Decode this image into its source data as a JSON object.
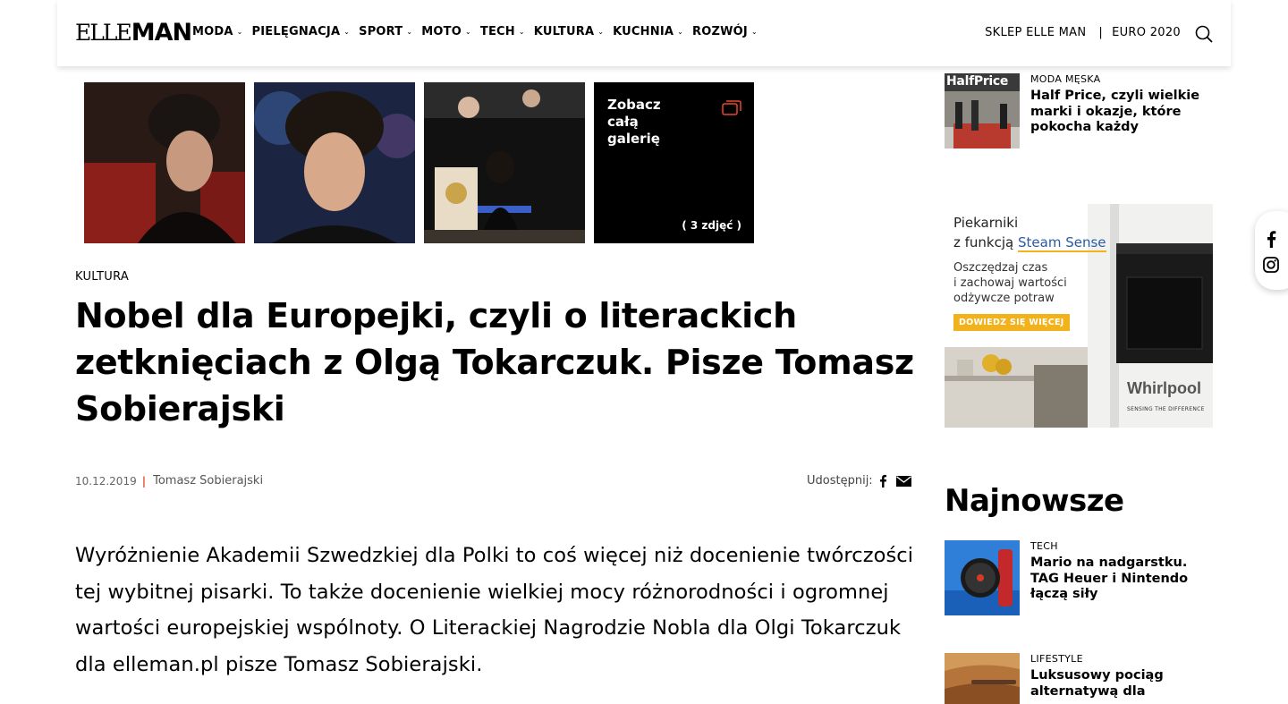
{
  "header": {
    "logo_elle": "ELLE",
    "logo_man": "MAN",
    "nav": [
      "MODA",
      "PIELĘGNACJA",
      "SPORT",
      "MOTO",
      "TECH",
      "KULTURA",
      "KUCHNIA",
      "ROZWÓJ"
    ],
    "shop_link": "SKLEP ELLE MAN",
    "separator": "|",
    "euro_link": "EURO 2020"
  },
  "gallery": {
    "more_label": "Zobacz całą galerię",
    "count": "( 3 zdjęć )"
  },
  "article": {
    "category": "KULTURA",
    "title": "Nobel dla Europejki, czyli o literackich zetknięciach z Olgą Tokarczuk. Pisze Tomasz Sobierajski",
    "date": "10.12.2019",
    "meta_separator": "|",
    "author": "Tomasz Sobierajski",
    "share_label": "Udostępnij:",
    "lead": "Wyróżnienie Akademii Szwedzkiej dla Polki to coś więcej niż docenienie twórczości tej wybitnej pisarki. To także docenienie wielkiej mocy różnorodności i ogromnej wartości europejskiej wspólnoty. O Literackiej Nagrodzie Nobla dla Olgi Tokarczuk dla elleman.pl pisze Tomasz Sobierajski."
  },
  "sidebar": {
    "top_item": {
      "thumb_text": "HalfPrice",
      "category": "MODA MĘSKA",
      "title": "Half Price, czyli wielkie marki i okazje, które pokocha każdy"
    },
    "ad": {
      "line1": "Piekarniki",
      "line2_prefix": "z funkcją ",
      "line2_highlight": "Steam Sense",
      "line3": "Oszczędzaj czas",
      "line4": "i zachowaj wartości",
      "line5": "odżywcze potraw",
      "button": "DOWIEDZ SIĘ WIĘCEJ",
      "brand": "Whirlpool",
      "tagline": "SENSING THE DIFFERENCE"
    },
    "section_title": "Najnowsze",
    "latest": [
      {
        "category": "TECH",
        "title": "Mario na nadgarstku. TAG Heuer i Nintendo łączą siły"
      },
      {
        "category": "LIFESTYLE",
        "title": "Luksusowy pociąg alternatywą dla"
      }
    ]
  },
  "colors": {
    "accent_red": "#e8472b",
    "ad_yellow": "#f2b21b",
    "ad_blue": "#2a5aa8"
  },
  "icons": [
    "search-icon",
    "gallery-icon",
    "facebook-icon",
    "mail-icon",
    "instagram-icon",
    "chevron-down-icon"
  ]
}
